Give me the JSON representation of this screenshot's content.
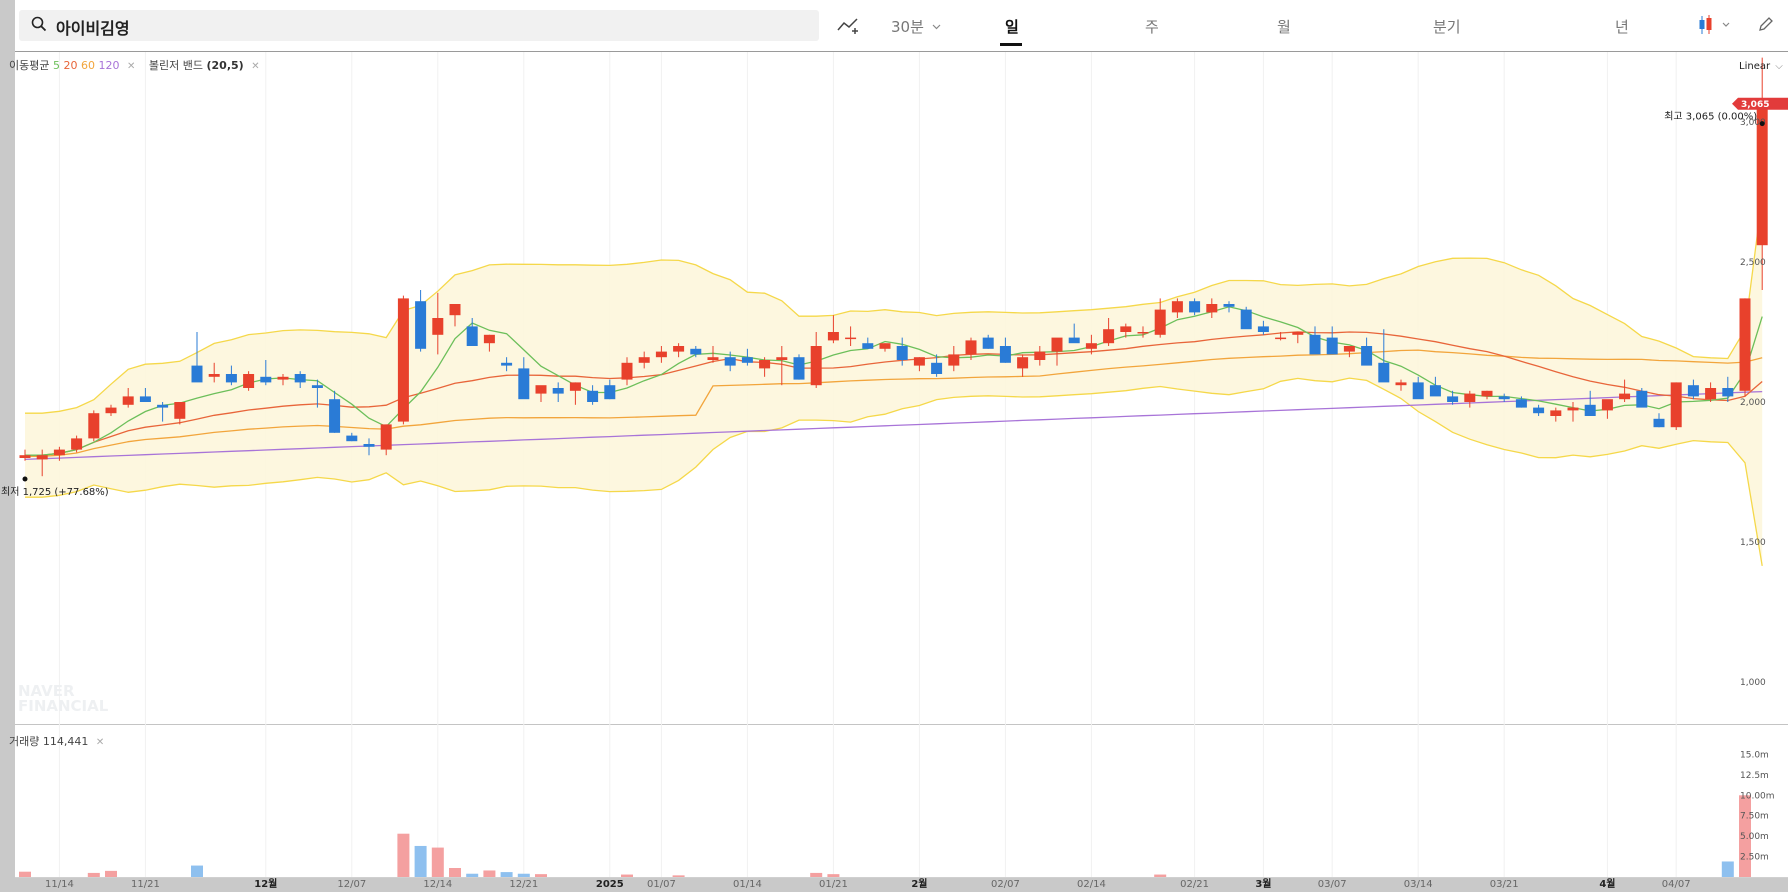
{
  "search": {
    "value": "아이비김영"
  },
  "toolbar": {
    "interval_label": "30분",
    "tabs": [
      "일",
      "주",
      "월",
      "분기",
      "년"
    ],
    "active_tab": "일"
  },
  "legend": {
    "ma_label": "이동평균",
    "ma_periods": [
      "5",
      "20",
      "60",
      "120"
    ],
    "bollinger_label": "볼린저 밴드",
    "bollinger_params": "(20,5)",
    "volume_label": "거래량",
    "volume_value": "114,441"
  },
  "scale": {
    "type": "Linear"
  },
  "watermark": [
    "NAVER",
    "FINANCIAL"
  ],
  "colors": {
    "up": "#e8412c",
    "down": "#2a7bd6",
    "ma5": "#6cbf5a",
    "ma20": "#e8653a",
    "ma60": "#f2a53c",
    "ma120": "#a874d8",
    "band": "#f5d84a",
    "band_fill": "#fdf6dc",
    "volume_up": "#f4a0a0",
    "volume_down": "#8ec0ef"
  },
  "chart_data": {
    "type": "candlestick",
    "price_axis": {
      "ticks": [
        "1,000",
        "1,500",
        "2,000",
        "2,500",
        "3,000"
      ],
      "ylim": [
        850,
        3250
      ]
    },
    "volume_axis": {
      "ticks": [
        "2.50m",
        "5.00m",
        "7.50m",
        "10.00m",
        "12.5m",
        "15.0m"
      ],
      "ylim": [
        0,
        17500000
      ]
    },
    "x_ticks": [
      "11/14",
      "11/21",
      "12월",
      "12/07",
      "12/14",
      "12/21",
      "2025",
      "01/07",
      "01/14",
      "01/21",
      "2월",
      "02/07",
      "02/14",
      "02/21",
      "3월",
      "03/07",
      "03/14",
      "03/21",
      "4월",
      "04/07"
    ],
    "x_tick_bold": [
      false,
      false,
      true,
      false,
      false,
      false,
      true,
      false,
      false,
      false,
      true,
      false,
      false,
      false,
      true,
      false,
      false,
      false,
      true,
      false
    ],
    "x_tick_index": [
      2,
      7,
      14,
      19,
      24,
      29,
      34,
      37,
      42,
      47,
      52,
      57,
      62,
      68,
      72,
      76,
      81,
      86,
      92,
      96
    ],
    "ohlc": [
      [
        1800,
        1830,
        1790,
        1810
      ],
      [
        1795,
        1830,
        1735,
        1810
      ],
      [
        1810,
        1840,
        1790,
        1830
      ],
      [
        1830,
        1880,
        1820,
        1870
      ],
      [
        1870,
        1970,
        1860,
        1960
      ],
      [
        1960,
        1990,
        1950,
        1980
      ],
      [
        1990,
        2050,
        1980,
        2020
      ],
      [
        2020,
        2050,
        2000,
        2000
      ],
      [
        1990,
        2000,
        1930,
        1980
      ],
      [
        1940,
        2000,
        1920,
        2000
      ],
      [
        2130,
        2250,
        2100,
        2070
      ],
      [
        2090,
        2140,
        2070,
        2100
      ],
      [
        2100,
        2130,
        2060,
        2070
      ],
      [
        2050,
        2110,
        2040,
        2100
      ],
      [
        2090,
        2150,
        2060,
        2070
      ],
      [
        2080,
        2100,
        2060,
        2090
      ],
      [
        2100,
        2110,
        2050,
        2070
      ],
      [
        2060,
        2080,
        1980,
        2050
      ],
      [
        2010,
        2040,
        1890,
        1890
      ],
      [
        1880,
        1890,
        1860,
        1860
      ],
      [
        1850,
        1870,
        1810,
        1840
      ],
      [
        1830,
        1920,
        1810,
        1920
      ],
      [
        1930,
        2380,
        1920,
        2370
      ],
      [
        2360,
        2400,
        2180,
        2190
      ],
      [
        2240,
        2390,
        2170,
        2300
      ],
      [
        2310,
        2340,
        2270,
        2350
      ],
      [
        2270,
        2300,
        2230,
        2200
      ],
      [
        2210,
        2240,
        2180,
        2240
      ],
      [
        2140,
        2160,
        2110,
        2130
      ],
      [
        2120,
        2160,
        2060,
        2010
      ],
      [
        2030,
        2050,
        2000,
        2060
      ],
      [
        2050,
        2070,
        2000,
        2030
      ],
      [
        2040,
        2070,
        1990,
        2070
      ],
      [
        2040,
        2060,
        1990,
        2000
      ],
      [
        2060,
        2080,
        2010,
        2010
      ],
      [
        2080,
        2160,
        2060,
        2140
      ],
      [
        2140,
        2180,
        2120,
        2160
      ],
      [
        2160,
        2200,
        2140,
        2180
      ],
      [
        2180,
        2210,
        2160,
        2200
      ],
      [
        2190,
        2200,
        2160,
        2170
      ],
      [
        2150,
        2200,
        2140,
        2160
      ],
      [
        2160,
        2180,
        2110,
        2130
      ],
      [
        2160,
        2190,
        2130,
        2140
      ],
      [
        2120,
        2160,
        2090,
        2150
      ],
      [
        2150,
        2200,
        2060,
        2160
      ],
      [
        2160,
        2170,
        2080,
        2080
      ],
      [
        2060,
        2250,
        2050,
        2200
      ],
      [
        2220,
        2310,
        2210,
        2250
      ],
      [
        2230,
        2270,
        2200,
        2230
      ],
      [
        2210,
        2230,
        2190,
        2190
      ],
      [
        2190,
        2210,
        2180,
        2210
      ],
      [
        2200,
        2230,
        2130,
        2150
      ],
      [
        2130,
        2160,
        2110,
        2160
      ],
      [
        2140,
        2170,
        2090,
        2100
      ],
      [
        2130,
        2200,
        2110,
        2170
      ],
      [
        2170,
        2230,
        2150,
        2220
      ],
      [
        2230,
        2240,
        2190,
        2190
      ],
      [
        2200,
        2230,
        2140,
        2140
      ],
      [
        2120,
        2170,
        2090,
        2160
      ],
      [
        2150,
        2200,
        2130,
        2180
      ],
      [
        2180,
        2220,
        2130,
        2230
      ],
      [
        2230,
        2280,
        2220,
        2210
      ],
      [
        2190,
        2240,
        2170,
        2210
      ],
      [
        2210,
        2300,
        2200,
        2260
      ],
      [
        2250,
        2280,
        2230,
        2270
      ],
      [
        2250,
        2270,
        2230,
        2250
      ],
      [
        2240,
        2370,
        2230,
        2330
      ],
      [
        2320,
        2370,
        2300,
        2360
      ],
      [
        2360,
        2370,
        2310,
        2320
      ],
      [
        2320,
        2370,
        2300,
        2350
      ],
      [
        2350,
        2360,
        2320,
        2340
      ],
      [
        2330,
        2340,
        2290,
        2260
      ],
      [
        2270,
        2290,
        2240,
        2250
      ],
      [
        2230,
        2250,
        2220,
        2230
      ],
      [
        2240,
        2250,
        2210,
        2250
      ],
      [
        2240,
        2270,
        2190,
        2170
      ],
      [
        2230,
        2270,
        2190,
        2170
      ],
      [
        2180,
        2200,
        2160,
        2200
      ],
      [
        2200,
        2230,
        2170,
        2130
      ],
      [
        2140,
        2260,
        2130,
        2070
      ],
      [
        2060,
        2080,
        2040,
        2070
      ],
      [
        2070,
        2090,
        2020,
        2010
      ],
      [
        2060,
        2090,
        2040,
        2020
      ],
      [
        2020,
        2040,
        1990,
        2000
      ],
      [
        2000,
        2040,
        1980,
        2030
      ],
      [
        2020,
        2040,
        2010,
        2040
      ],
      [
        2020,
        2030,
        2000,
        2010
      ],
      [
        2010,
        2020,
        1980,
        1980
      ],
      [
        1980,
        1990,
        1950,
        1960
      ],
      [
        1950,
        1980,
        1930,
        1970
      ],
      [
        1970,
        2000,
        1930,
        1980
      ],
      [
        1990,
        2040,
        1970,
        1950
      ],
      [
        1970,
        1990,
        1940,
        2010
      ],
      [
        2010,
        2080,
        2000,
        2030
      ],
      [
        2040,
        2050,
        1990,
        1980
      ],
      [
        1940,
        1960,
        1910,
        1910
      ],
      [
        1910,
        2070,
        1900,
        2070
      ],
      [
        2060,
        2080,
        2010,
        2020
      ],
      [
        2010,
        2070,
        2000,
        2050
      ],
      [
        2050,
        2090,
        2000,
        2020
      ],
      [
        2040,
        2370,
        2020,
        2370
      ],
      [
        2560,
        3230,
        2400,
        3065
      ]
    ],
    "volume": [
      650000,
      0,
      0,
      0,
      500000,
      750000,
      0,
      0,
      0,
      0,
      1400000,
      0,
      0,
      0,
      0,
      0,
      0,
      0,
      0,
      0,
      0,
      0,
      5300000,
      3800000,
      3600000,
      1100000,
      400000,
      800000,
      600000,
      400000,
      350000,
      0,
      0,
      0,
      0,
      300000,
      0,
      0,
      200000,
      0,
      0,
      0,
      0,
      0,
      0,
      0,
      500000,
      350000,
      0,
      0,
      0,
      0,
      0,
      0,
      0,
      0,
      0,
      0,
      0,
      0,
      0,
      0,
      0,
      0,
      0,
      0,
      300000,
      0,
      0,
      0,
      0,
      0,
      0,
      0,
      0,
      0,
      0,
      0,
      0,
      0,
      0,
      0,
      0,
      0,
      0,
      0,
      0,
      0,
      0,
      0,
      0,
      0,
      0,
      0,
      0,
      0,
      0,
      0,
      0,
      1900000,
      10000000
    ],
    "markers": {
      "high_label": "최고 3,065 (0.00%)",
      "low_label": "최저 1,725 (+77.68%)",
      "last_price": "3,065"
    }
  }
}
